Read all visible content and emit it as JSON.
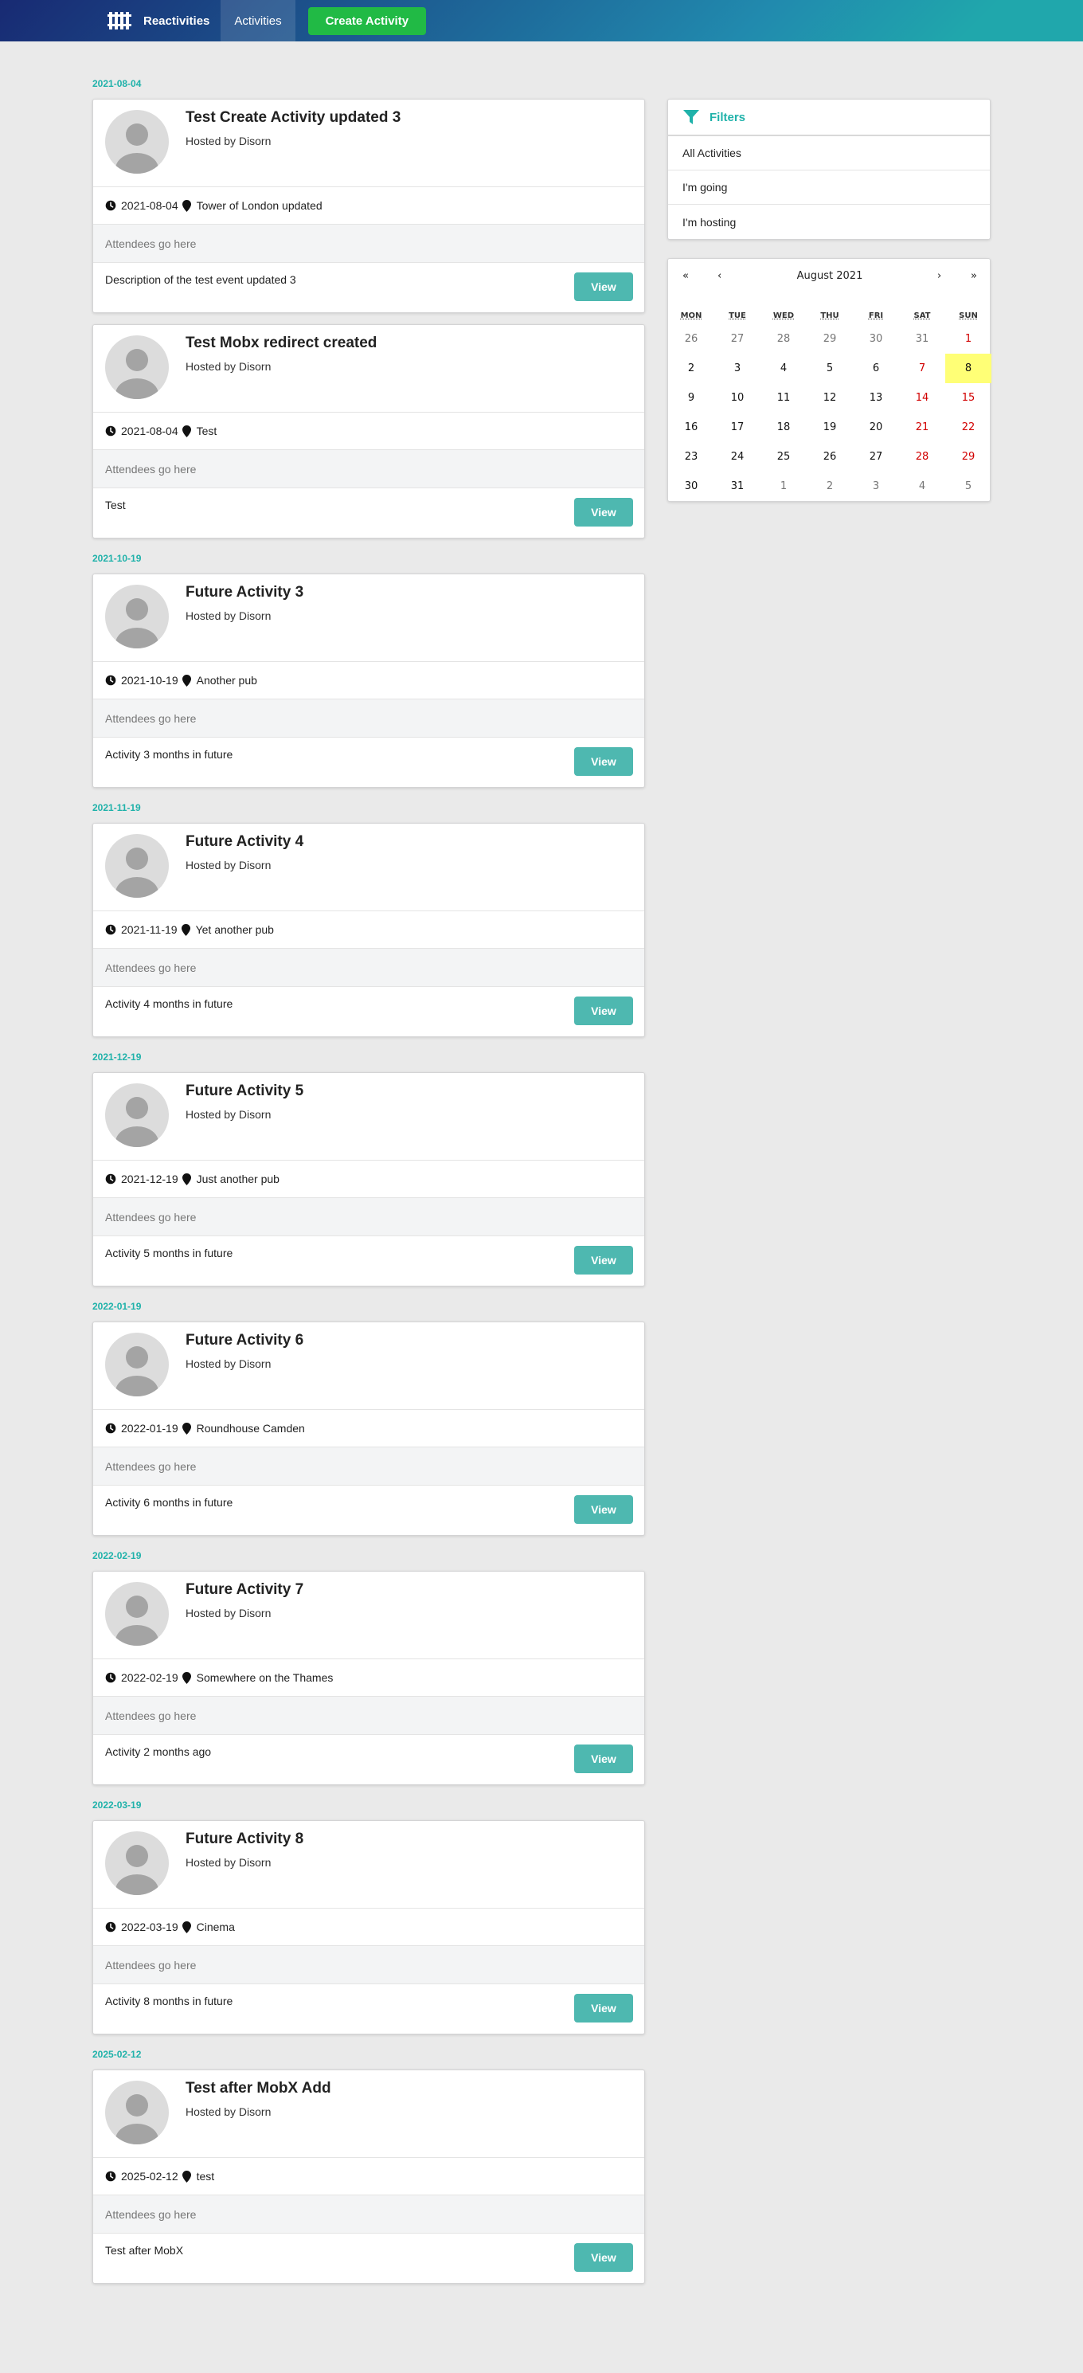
{
  "nav": {
    "brand": "Reactivities",
    "activities": "Activities",
    "create": "Create Activity"
  },
  "groups": [
    {
      "date": "2021-08-04",
      "activities": [
        {
          "title": "Test Create Activity updated 3",
          "host": "Hosted by Disorn",
          "date": "2021-08-04",
          "venue": "Tower of London updated",
          "attendees": "Attendees go here",
          "description": "Description of the test event updated 3",
          "view": "View"
        },
        {
          "title": "Test Mobx redirect created",
          "host": "Hosted by Disorn",
          "date": "2021-08-04",
          "venue": "Test",
          "attendees": "Attendees go here",
          "description": "Test",
          "view": "View"
        }
      ]
    },
    {
      "date": "2021-10-19",
      "activities": [
        {
          "title": "Future Activity 3",
          "host": "Hosted by Disorn",
          "date": "2021-10-19",
          "venue": "Another pub",
          "attendees": "Attendees go here",
          "description": "Activity 3 months in future",
          "view": "View"
        }
      ]
    },
    {
      "date": "2021-11-19",
      "activities": [
        {
          "title": "Future Activity 4",
          "host": "Hosted by Disorn",
          "date": "2021-11-19",
          "venue": "Yet another pub",
          "attendees": "Attendees go here",
          "description": "Activity 4 months in future",
          "view": "View"
        }
      ]
    },
    {
      "date": "2021-12-19",
      "activities": [
        {
          "title": "Future Activity 5",
          "host": "Hosted by Disorn",
          "date": "2021-12-19",
          "venue": "Just another pub",
          "attendees": "Attendees go here",
          "description": "Activity 5 months in future",
          "view": "View"
        }
      ]
    },
    {
      "date": "2022-01-19",
      "activities": [
        {
          "title": "Future Activity 6",
          "host": "Hosted by Disorn",
          "date": "2022-01-19",
          "venue": "Roundhouse Camden",
          "attendees": "Attendees go here",
          "description": "Activity 6 months in future",
          "view": "View"
        }
      ]
    },
    {
      "date": "2022-02-19",
      "activities": [
        {
          "title": "Future Activity 7",
          "host": "Hosted by Disorn",
          "date": "2022-02-19",
          "venue": "Somewhere on the Thames",
          "attendees": "Attendees go here",
          "description": "Activity 2 months ago",
          "view": "View"
        }
      ]
    },
    {
      "date": "2022-03-19",
      "activities": [
        {
          "title": "Future Activity 8",
          "host": "Hosted by Disorn",
          "date": "2022-03-19",
          "venue": "Cinema",
          "attendees": "Attendees go here",
          "description": "Activity 8 months in future",
          "view": "View"
        }
      ]
    },
    {
      "date": "2025-02-12",
      "activities": [
        {
          "title": "Test after MobX Add",
          "host": "Hosted by Disorn",
          "date": "2025-02-12",
          "venue": "test",
          "attendees": "Attendees go here",
          "description": "Test after MobX",
          "view": "View"
        }
      ]
    }
  ],
  "filters": {
    "title": "Filters",
    "items": [
      "All Activities",
      "I'm going",
      "I'm hosting"
    ]
  },
  "calendar": {
    "label": "August 2021",
    "prev2": "«",
    "prev": "‹",
    "next": "›",
    "next2": "»",
    "weekdays": [
      "MON",
      "TUE",
      "WED",
      "THU",
      "FRI",
      "SAT",
      "SUN"
    ],
    "weeks": [
      [
        {
          "d": "26",
          "m": "other"
        },
        {
          "d": "27",
          "m": "other"
        },
        {
          "d": "28",
          "m": "other"
        },
        {
          "d": "29",
          "m": "other"
        },
        {
          "d": "30",
          "m": "other"
        },
        {
          "d": "31",
          "m": "other"
        },
        {
          "d": "1",
          "m": "weekend"
        }
      ],
      [
        {
          "d": "2"
        },
        {
          "d": "3"
        },
        {
          "d": "4"
        },
        {
          "d": "5"
        },
        {
          "d": "6"
        },
        {
          "d": "7",
          "m": "weekend"
        },
        {
          "d": "8",
          "m": "today"
        }
      ],
      [
        {
          "d": "9"
        },
        {
          "d": "10"
        },
        {
          "d": "11"
        },
        {
          "d": "12"
        },
        {
          "d": "13"
        },
        {
          "d": "14",
          "m": "weekend"
        },
        {
          "d": "15",
          "m": "weekend"
        }
      ],
      [
        {
          "d": "16"
        },
        {
          "d": "17"
        },
        {
          "d": "18"
        },
        {
          "d": "19"
        },
        {
          "d": "20"
        },
        {
          "d": "21",
          "m": "weekend"
        },
        {
          "d": "22",
          "m": "weekend"
        }
      ],
      [
        {
          "d": "23"
        },
        {
          "d": "24"
        },
        {
          "d": "25"
        },
        {
          "d": "26"
        },
        {
          "d": "27"
        },
        {
          "d": "28",
          "m": "weekend"
        },
        {
          "d": "29",
          "m": "weekend"
        }
      ],
      [
        {
          "d": "30"
        },
        {
          "d": "31"
        },
        {
          "d": "1",
          "m": "other"
        },
        {
          "d": "2",
          "m": "other"
        },
        {
          "d": "3",
          "m": "other"
        },
        {
          "d": "4",
          "m": "other"
        },
        {
          "d": "5",
          "m": "other"
        }
      ]
    ]
  },
  "colors": {
    "accent": "#20b2aa",
    "create_button": "#21ba45",
    "view_button": "#4eb8b0",
    "today": "#ffff76",
    "weekend": "#d10000"
  }
}
